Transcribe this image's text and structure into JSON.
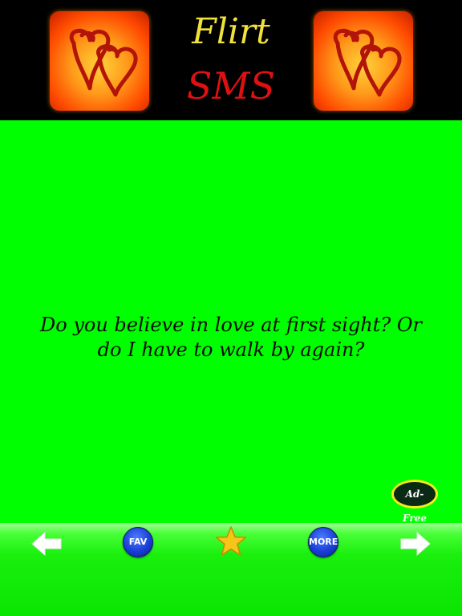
{
  "header": {
    "title_line1": "Flirt",
    "title_line2": "SMS",
    "left_logo_icon": "double-heart-icon",
    "right_logo_icon": "double-heart-icon"
  },
  "message": {
    "text": "Do you believe in love at first sight? Or do I have to walk by again?"
  },
  "ad_free": {
    "label": "Ad-Free"
  },
  "toolbar": {
    "prev_icon": "arrow-left-icon",
    "fav_label": "FAV",
    "star_icon": "star-icon",
    "more_label": "MORE",
    "next_icon": "arrow-right-icon"
  },
  "colors": {
    "background": "#00ff00",
    "header_bg": "#000000",
    "title_line1": "#f1e23a",
    "title_line2": "#e01010",
    "button_blue": "#1a3fd6",
    "star": "#f5c518",
    "badge_border": "#f2ee1c"
  }
}
